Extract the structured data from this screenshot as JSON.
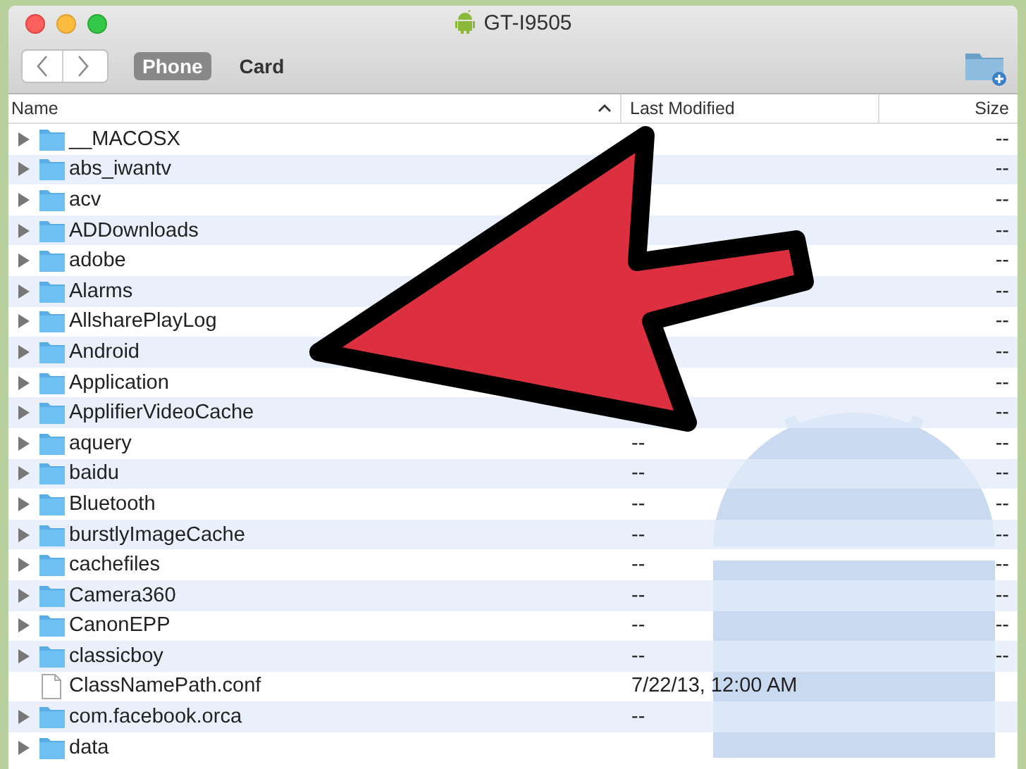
{
  "window": {
    "title": "GT-I9505"
  },
  "toolbar": {
    "storage_tabs": [
      {
        "label": "Phone",
        "selected": true
      },
      {
        "label": "Card",
        "selected": false
      }
    ]
  },
  "table": {
    "columns": [
      {
        "label": "Name",
        "sorted": true
      },
      {
        "label": "Last Modified",
        "sorted": false
      },
      {
        "label": "Size",
        "sorted": false
      }
    ],
    "rows": [
      {
        "kind": "folder",
        "name": "__MACOSX",
        "size": "--"
      },
      {
        "kind": "folder",
        "name": "abs_iwantv",
        "size": "--"
      },
      {
        "kind": "folder",
        "name": "acv",
        "size": "--"
      },
      {
        "kind": "folder",
        "name": "ADDownloads",
        "size": "--"
      },
      {
        "kind": "folder",
        "name": "adobe",
        "size": "--"
      },
      {
        "kind": "folder",
        "name": "Alarms",
        "size": "--"
      },
      {
        "kind": "folder",
        "name": "AllsharePlayLog",
        "size": "--"
      },
      {
        "kind": "folder",
        "name": "Android",
        "size": "--"
      },
      {
        "kind": "folder",
        "name": "Application",
        "size": "--"
      },
      {
        "kind": "folder",
        "name": "ApplifierVideoCache",
        "size": "--"
      },
      {
        "kind": "folder",
        "name": "aquery",
        "modified": "--",
        "size": "--"
      },
      {
        "kind": "folder",
        "name": "baidu",
        "modified": "--",
        "size": "--"
      },
      {
        "kind": "folder",
        "name": "Bluetooth",
        "modified": "--",
        "size": "--"
      },
      {
        "kind": "folder",
        "name": "burstlyImageCache",
        "modified": "--",
        "size": "--"
      },
      {
        "kind": "folder",
        "name": "cachefiles",
        "modified": "--",
        "size": "--"
      },
      {
        "kind": "folder",
        "name": "Camera360",
        "modified": "--",
        "size": "--"
      },
      {
        "kind": "folder",
        "name": "CanonEPP",
        "modified": "--",
        "size": "--"
      },
      {
        "kind": "folder",
        "name": "classicboy",
        "modified": "--",
        "size": "--"
      },
      {
        "kind": "file",
        "name": "ClassNamePath.conf",
        "modified": "7/22/13, 12:00 AM"
      },
      {
        "kind": "folder",
        "name": "com.facebook.orca",
        "modified": "--"
      },
      {
        "kind": "folder",
        "name": "data"
      }
    ]
  }
}
